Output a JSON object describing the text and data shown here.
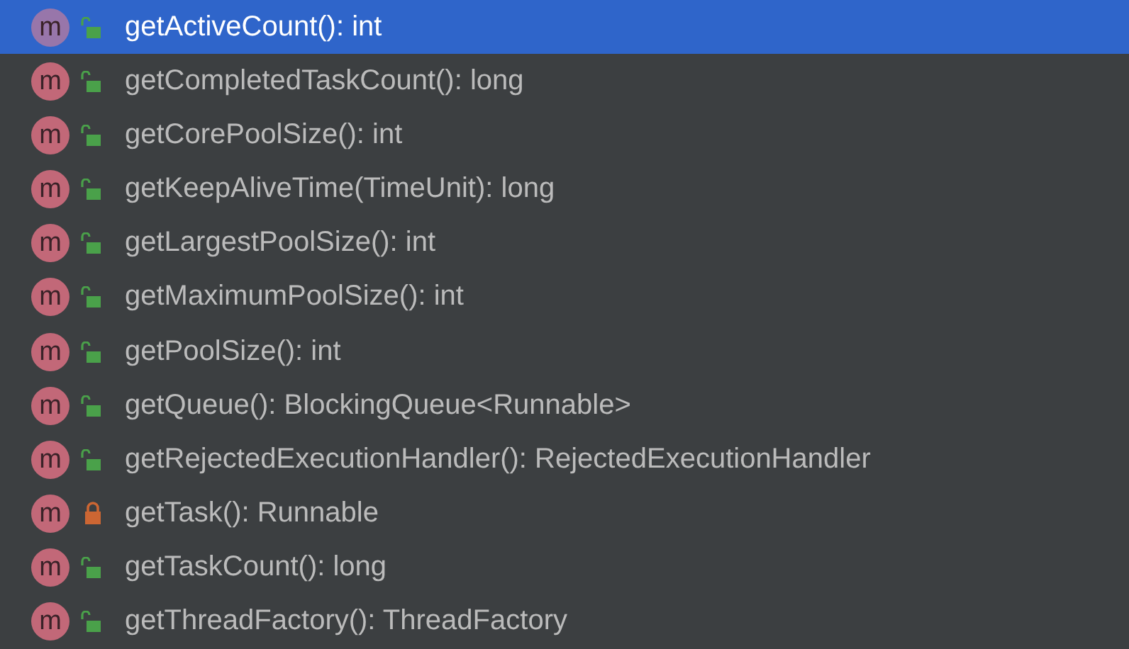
{
  "members": [
    {
      "badge": "m",
      "kind": "public",
      "label": "getActiveCount(): int",
      "selected": true
    },
    {
      "badge": "m",
      "kind": "public",
      "label": "getCompletedTaskCount(): long",
      "selected": false
    },
    {
      "badge": "m",
      "kind": "public",
      "label": "getCorePoolSize(): int",
      "selected": false
    },
    {
      "badge": "m",
      "kind": "public",
      "label": "getKeepAliveTime(TimeUnit): long",
      "selected": false
    },
    {
      "badge": "m",
      "kind": "public",
      "label": "getLargestPoolSize(): int",
      "selected": false
    },
    {
      "badge": "m",
      "kind": "public",
      "label": "getMaximumPoolSize(): int",
      "selected": false
    },
    {
      "badge": "m",
      "kind": "public",
      "label": "getPoolSize(): int",
      "selected": false
    },
    {
      "badge": "m",
      "kind": "public",
      "label": "getQueue(): BlockingQueue<Runnable>",
      "selected": false
    },
    {
      "badge": "m",
      "kind": "public",
      "label": "getRejectedExecutionHandler(): RejectedExecutionHandler",
      "selected": false
    },
    {
      "badge": "m",
      "kind": "private",
      "label": "getTask(): Runnable",
      "selected": false
    },
    {
      "badge": "m",
      "kind": "public",
      "label": "getTaskCount(): long",
      "selected": false
    },
    {
      "badge": "m",
      "kind": "public",
      "label": "getThreadFactory(): ThreadFactory",
      "selected": false
    }
  ]
}
